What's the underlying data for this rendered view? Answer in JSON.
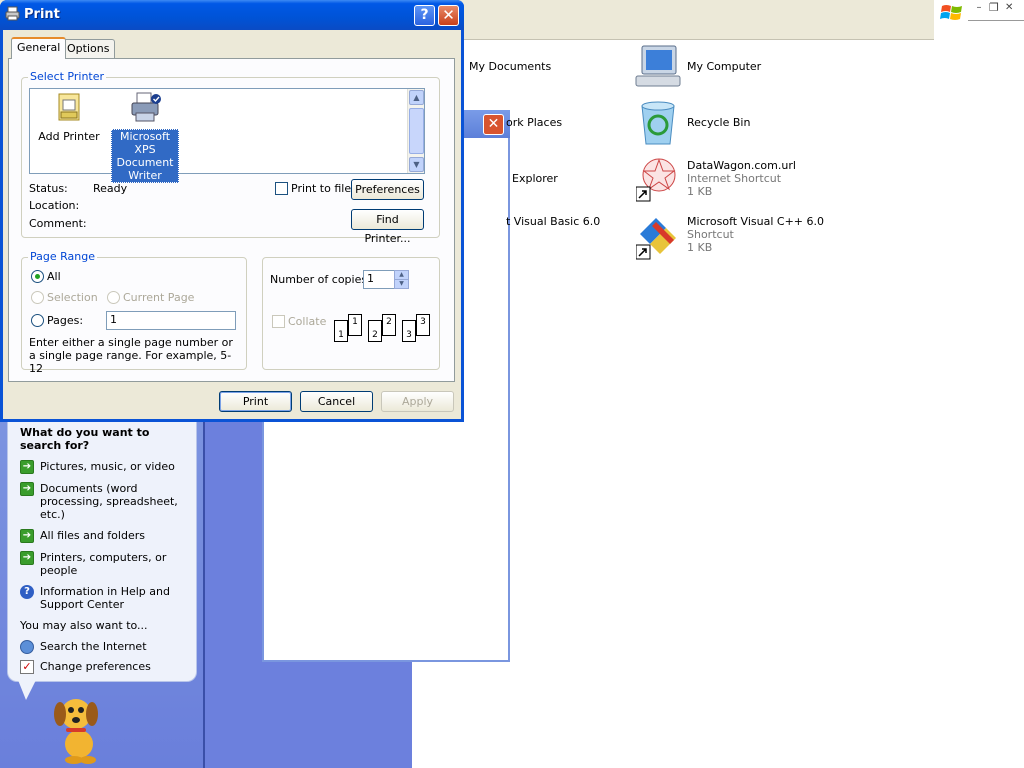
{
  "dialog": {
    "title": "Print",
    "tabs": [
      {
        "label": "General"
      },
      {
        "label": "Options"
      }
    ],
    "select_printer": {
      "group_label": "Select Printer",
      "printers": [
        {
          "name": "Add Printer"
        },
        {
          "name": "Microsoft XPS Document Writer",
          "selected": true
        }
      ],
      "status_label": "Status:",
      "status_value": "Ready",
      "location_label": "Location:",
      "comment_label": "Comment:",
      "print_to_file": "Print to file",
      "preferences": "Preferences",
      "find_printer": "Find Printer..."
    },
    "page_range": {
      "group_label": "Page Range",
      "all": "All",
      "selection": "Selection",
      "current_page": "Current Page",
      "pages": "Pages:",
      "pages_value": "1",
      "hint": "Enter either a single page number or a single page range.  For example, 5-12"
    },
    "copies": {
      "label": "Number of copies:",
      "value": "1",
      "collate": "Collate",
      "page_numbers": [
        "1",
        "1",
        "2",
        "2",
        "3",
        "3"
      ]
    },
    "buttons": {
      "print": "Print",
      "cancel": "Cancel",
      "apply": "Apply"
    }
  },
  "desktop": {
    "my_documents": "My Documents",
    "network_places": "ork Places",
    "explorer": "Explorer",
    "vb": "t Visual Basic 6.0",
    "my_computer": "My Computer",
    "recycle_bin": "Recycle Bin",
    "datawagon": {
      "name": "DataWagon.com.url",
      "type": "Internet Shortcut",
      "size": "1 KB"
    },
    "vcpp": {
      "name": "Microsoft Visual C++ 6.0",
      "type": "Shortcut",
      "size": "1 KB"
    }
  },
  "search": {
    "heading": "What do you want to search for?",
    "items": [
      {
        "label": "Pictures, music, or video"
      },
      {
        "label": "Documents (word processing, spreadsheet, etc.)"
      },
      {
        "label": "All files and folders"
      },
      {
        "label": "Printers, computers, or people"
      },
      {
        "label": "Information in Help and Support Center"
      }
    ],
    "also_label": "You may also want to...",
    "also_items": [
      {
        "label": "Search the Internet"
      },
      {
        "label": "Change preferences"
      }
    ]
  },
  "colors": {
    "xp_blue": "#0053d6",
    "group_label": "#0046d5",
    "selection": "#316ac5"
  }
}
